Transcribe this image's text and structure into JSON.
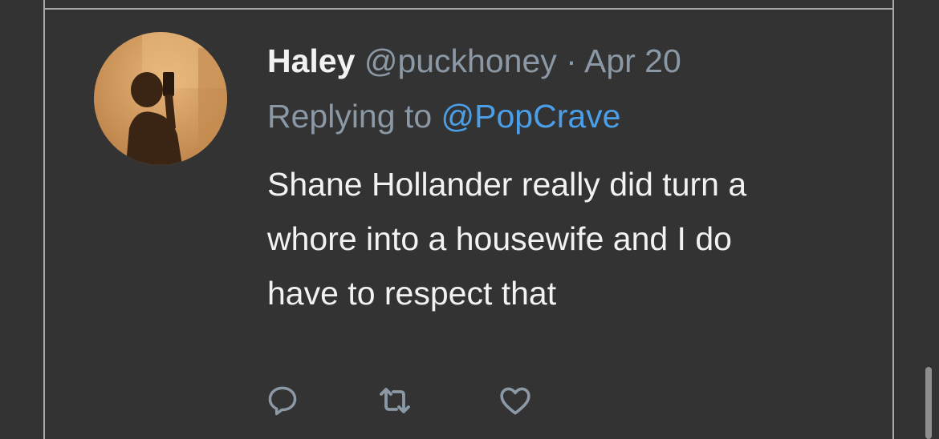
{
  "tweet": {
    "display_name": "Haley",
    "handle": "@puckhoney",
    "separator": "·",
    "date": "Apr 20",
    "replying_to_label": "Replying to",
    "replying_to_handle": "@PopCrave",
    "text_lines": [
      "Shane Hollander really did turn a",
      "whore into a housewife and I do",
      "have to respect that"
    ]
  },
  "actions": [
    {
      "name": "reply",
      "icon": "comment-icon"
    },
    {
      "name": "retweet",
      "icon": "retweet-icon"
    },
    {
      "name": "like",
      "icon": "heart-icon"
    }
  ],
  "colors": {
    "background": "#333333",
    "primary_text": "#f2f2f2",
    "secondary_text": "#8b98a5",
    "link": "#4a9fe8",
    "border": "#a8a8a8"
  }
}
